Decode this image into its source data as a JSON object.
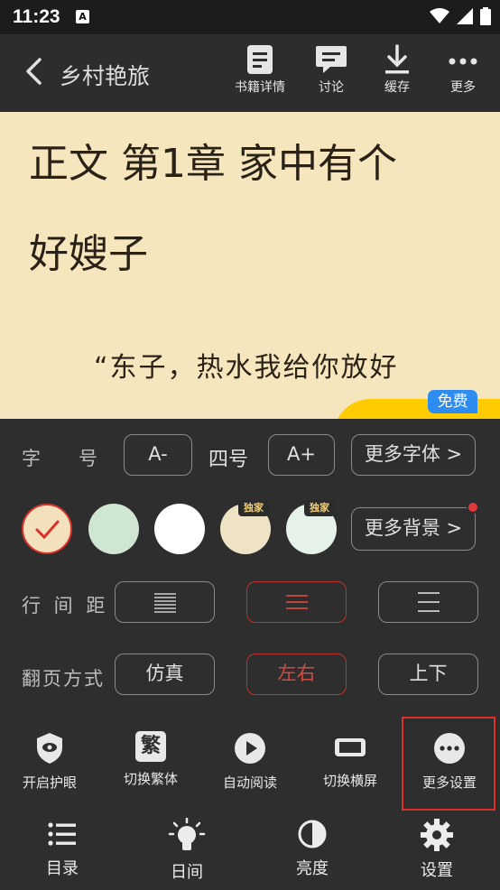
{
  "status": {
    "time": "11:23",
    "notif": "A"
  },
  "header": {
    "title": "乡村艳旅",
    "actions": [
      {
        "label": "书籍详情",
        "icon": "book-details-icon"
      },
      {
        "label": "讨论",
        "icon": "chat-icon"
      },
      {
        "label": "缓存",
        "icon": "download-icon"
      },
      {
        "label": "更多",
        "icon": "more-dots-icon"
      }
    ]
  },
  "reader": {
    "chapter_line1": "正文 第1章 家中有个",
    "chapter_line2": "好嫂子",
    "paragraph": "“东子，热水我给你放好",
    "free_badge": "免费"
  },
  "settings": {
    "font_label": "字　　号",
    "font_decrease": "A-",
    "font_size": "四号",
    "font_increase": "A+",
    "more_fonts": "更多字体 >",
    "backgrounds": {
      "colors": [
        "#f3e0bd",
        "#cfe6d2",
        "#ffffff",
        "#efe3c6",
        "#e6f1ea"
      ],
      "exclusive_tag": "独家",
      "more": "更多背景 >"
    },
    "spacing_label": "行 间 距",
    "page_turn_label": "翻页方式",
    "page_turn_options": [
      "仿真",
      "左右",
      "上下"
    ]
  },
  "tools": [
    {
      "label": "开启护眼",
      "icon": "eye-shield-icon"
    },
    {
      "label": "切换繁体",
      "icon": "traditional-char-icon",
      "glyph": "繁"
    },
    {
      "label": "自动阅读",
      "icon": "play-icon"
    },
    {
      "label": "切换横屏",
      "icon": "landscape-icon"
    },
    {
      "label": "更多设置",
      "icon": "more-settings-icon"
    }
  ],
  "nav": [
    {
      "label": "目录",
      "icon": "list-icon"
    },
    {
      "label": "日间",
      "icon": "lightbulb-icon"
    },
    {
      "label": "亮度",
      "icon": "brightness-icon"
    },
    {
      "label": "设置",
      "icon": "gear-icon"
    }
  ],
  "colors": {
    "accent_red": "#d9322a",
    "reader_bg": "#f6e6bd",
    "free_blue": "#2d8cf0"
  }
}
